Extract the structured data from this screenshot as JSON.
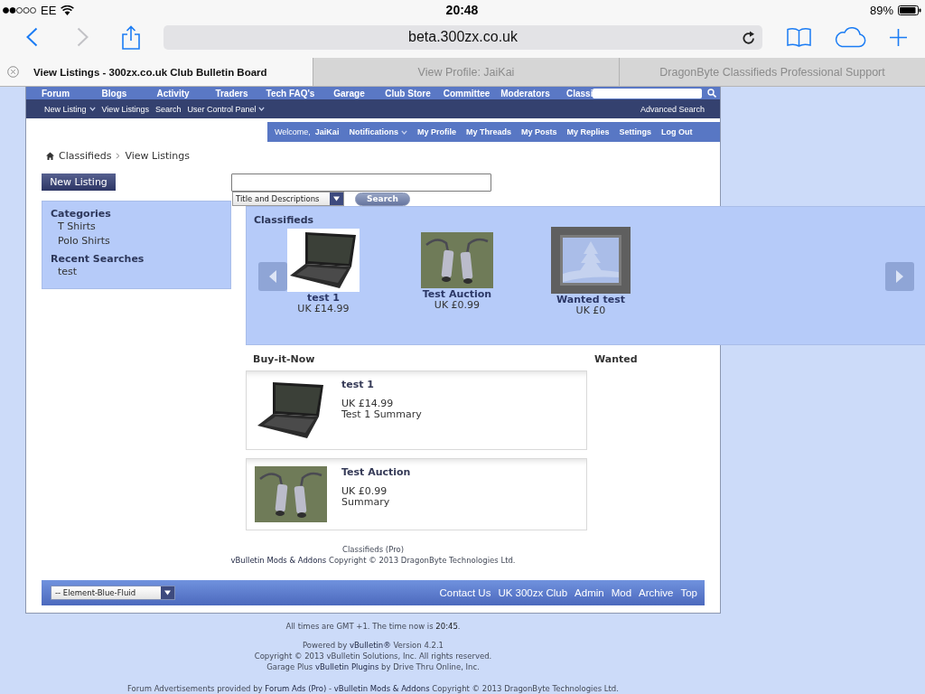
{
  "status_bar": {
    "carrier": "EE",
    "time": "20:48",
    "battery": "89%"
  },
  "browser": {
    "back_disabled": false,
    "forward_disabled": true,
    "url": "beta.300zx.co.uk",
    "tabs": [
      {
        "title": "View Listings - 300zx.co.uk Club Bulletin Board",
        "selected": true
      },
      {
        "title": "View Profile: JaiKai",
        "selected": false
      },
      {
        "title": "DragonByte Classifieds Professional Support",
        "selected": false
      }
    ]
  },
  "navbar": {
    "items": [
      "Forum",
      "Blogs",
      "Activity",
      "Traders",
      "Tech FAQ's",
      "Garage",
      "Club Store",
      "Committee",
      "Moderators",
      "Classi"
    ]
  },
  "subnav": {
    "items": [
      {
        "label": "New Listing",
        "menu": true
      },
      {
        "label": "View Listings",
        "menu": false
      },
      {
        "label": "Search",
        "menu": false
      },
      {
        "label": "User Control Panel",
        "menu": true
      }
    ],
    "right_link": "Advanced Search"
  },
  "user_bar": {
    "welcome": "Welcome,",
    "username": "JaiKai",
    "links": [
      {
        "label": "Notifications",
        "menu": true
      },
      {
        "label": "My Profile",
        "menu": false
      },
      {
        "label": "My Threads",
        "menu": false
      },
      {
        "label": "My Posts",
        "menu": false
      },
      {
        "label": "My Replies",
        "menu": false
      },
      {
        "label": "Settings",
        "menu": false
      },
      {
        "label": "Log Out",
        "menu": false
      }
    ]
  },
  "breadcrumb": [
    "Classifieds",
    "View Listings"
  ],
  "new_listing_button": "New Listing",
  "search": {
    "scope": "Title and Descriptions",
    "button": "Search"
  },
  "sidebar": {
    "sections": [
      {
        "title": "Categories",
        "items": [
          "T Shirts",
          "Polo Shirts"
        ]
      },
      {
        "title": "Recent Searches",
        "items": [
          "test"
        ]
      }
    ]
  },
  "carousel": {
    "title": "Classifieds",
    "items": [
      {
        "kind": "photo",
        "title": "test 1",
        "price": "UK £14.99"
      },
      {
        "kind": "photo",
        "title": "Test Auction",
        "price": "UK £0.99"
      },
      {
        "kind": "no_image",
        "title": "Wanted test",
        "price": "UK £0"
      }
    ]
  },
  "listing_columns": [
    {
      "title": "Buy-it-Now",
      "listings": [
        {
          "kind": "photo",
          "title": "test 1",
          "price": "UK £14.99",
          "summary": "Test 1 Summary"
        },
        {
          "kind": "photo",
          "title": "Test Auction",
          "price": "UK £0.99",
          "summary": "Summary"
        }
      ]
    },
    {
      "title": "Wanted"
    }
  ],
  "credits": [
    {
      "parts": [
        {
          "kind": "text",
          "text": "Classifieds (Pro)"
        }
      ]
    },
    {
      "parts": [
        {
          "kind": "link",
          "text": "vBulletin Mods & Addons"
        },
        {
          "kind": "text",
          "text": " Copyright © 2013 DragonByte Technologies Ltd."
        }
      ]
    }
  ],
  "footer_bar": {
    "style_select": "-- Element-Blue-Fluid",
    "links": [
      "Contact Us",
      "UK 300zx Club",
      "Admin",
      "Mod",
      "Archive",
      "Top"
    ]
  },
  "page_footer": [
    [
      {
        "parts": [
          {
            "kind": "text",
            "text": "All times are GMT +1. The time now is "
          },
          {
            "kind": "highlight",
            "text": "20:45"
          },
          {
            "kind": "text",
            "text": "."
          }
        ]
      }
    ],
    [
      {
        "parts": [
          {
            "kind": "text",
            "text": "Powered by "
          },
          {
            "kind": "link",
            "text": "vBulletin®"
          },
          {
            "kind": "text",
            "text": " Version 4.2.1"
          }
        ]
      },
      {
        "parts": [
          {
            "kind": "text",
            "text": "Copyright © 2013 vBulletin Solutions, Inc. All rights reserved."
          }
        ]
      },
      {
        "parts": [
          {
            "kind": "text",
            "text": "Garage Plus "
          },
          {
            "kind": "link",
            "text": "vBulletin Plugins"
          },
          {
            "kind": "text",
            "text": " by Drive Thru Online, Inc."
          }
        ]
      }
    ],
    [
      {
        "parts": [
          {
            "kind": "text",
            "text": "Forum Advertisements provided by "
          },
          {
            "kind": "link",
            "text": "Forum Ads (Pro)"
          },
          {
            "kind": "text",
            "text": " - "
          },
          {
            "kind": "link",
            "text": "vBulletin Mods & Addons"
          },
          {
            "kind": "text",
            "text": " Copyright © 2013 DragonByte Technologies Ltd."
          }
        ]
      }
    ]
  ]
}
